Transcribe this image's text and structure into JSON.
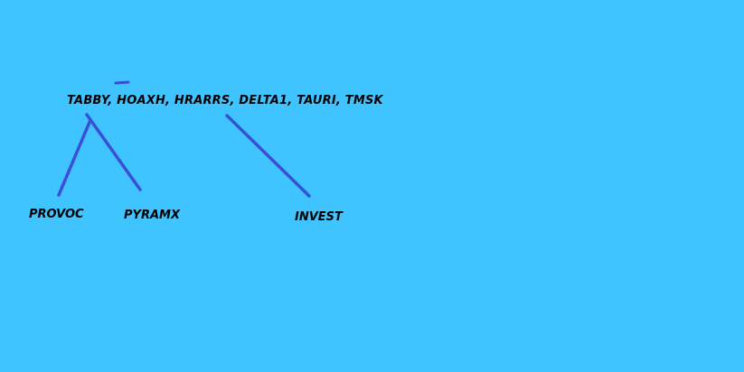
{
  "diagram": {
    "background_color": "#40c4ff",
    "stroke_color": "#3a4fd6",
    "text_color": "#000000",
    "main_text": "TABBY,  HOAXH,  HRARRS,  DELTA1,  TAURI,  TMSK",
    "leaves": {
      "provoc": "PROVOC",
      "pyramx": "PYRAMX",
      "invest": "INVEST"
    }
  }
}
